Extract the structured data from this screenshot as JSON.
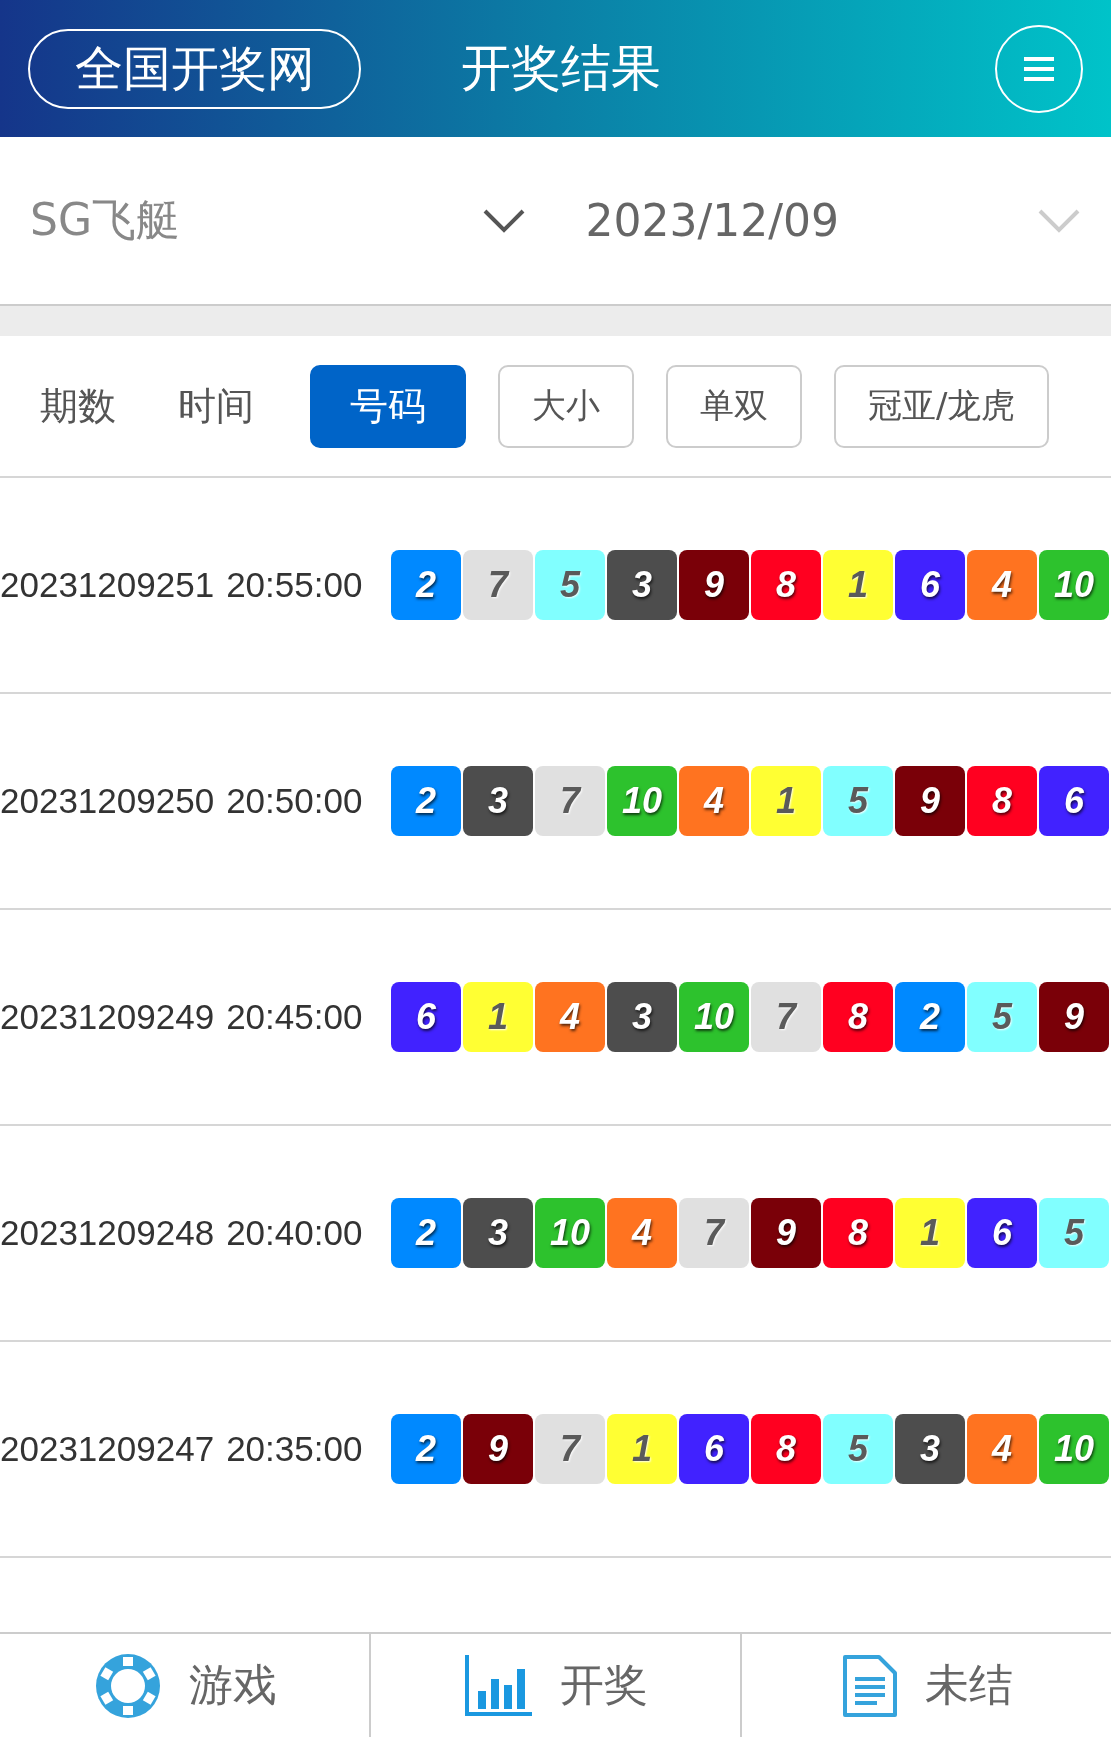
{
  "header": {
    "logo": "全国开奖网",
    "title": "开奖结果"
  },
  "filters": [
    {
      "value": "SG飞艇",
      "kind": "dark"
    },
    {
      "value": "2023/12/09",
      "kind": "light"
    }
  ],
  "tabs": [
    {
      "label": "期数",
      "kind": "text",
      "selected": false
    },
    {
      "label": "时间",
      "kind": "text",
      "selected": false
    },
    {
      "label": "号码",
      "kind": "button",
      "selected": true
    },
    {
      "label": "大小",
      "kind": "button",
      "selected": false
    },
    {
      "label": "单双",
      "kind": "button",
      "selected": false
    },
    {
      "label": "冠亚/龙虎",
      "kind": "button",
      "selected": false
    }
  ],
  "rows": [
    {
      "issue": "20231209251",
      "time": "20:55:00",
      "balls": [
        {
          "n": "2",
          "color": "#0089ff"
        },
        {
          "n": "7",
          "color": "#e0e0e0"
        },
        {
          "n": "5",
          "color": "#81ffff"
        },
        {
          "n": "3",
          "color": "#4d4d4d"
        },
        {
          "n": "9",
          "color": "#7a0008"
        },
        {
          "n": "8",
          "color": "#ff0020"
        },
        {
          "n": "1",
          "color": "#ffff33"
        },
        {
          "n": "6",
          "color": "#4122ff"
        },
        {
          "n": "4",
          "color": "#ff7320"
        },
        {
          "n": "10",
          "color": "#2dc22d"
        }
      ]
    },
    {
      "issue": "20231209250",
      "time": "20:50:00",
      "balls": [
        {
          "n": "2",
          "color": "#0089ff"
        },
        {
          "n": "3",
          "color": "#4d4d4d"
        },
        {
          "n": "7",
          "color": "#e0e0e0"
        },
        {
          "n": "10",
          "color": "#2dc22d"
        },
        {
          "n": "4",
          "color": "#ff7320"
        },
        {
          "n": "1",
          "color": "#ffff33"
        },
        {
          "n": "5",
          "color": "#81ffff"
        },
        {
          "n": "9",
          "color": "#7a0008"
        },
        {
          "n": "8",
          "color": "#ff0020"
        },
        {
          "n": "6",
          "color": "#4122ff"
        }
      ]
    },
    {
      "issue": "20231209249",
      "time": "20:45:00",
      "balls": [
        {
          "n": "6",
          "color": "#4122ff"
        },
        {
          "n": "1",
          "color": "#ffff33"
        },
        {
          "n": "4",
          "color": "#ff7320"
        },
        {
          "n": "3",
          "color": "#4d4d4d"
        },
        {
          "n": "10",
          "color": "#2dc22d"
        },
        {
          "n": "7",
          "color": "#e0e0e0"
        },
        {
          "n": "8",
          "color": "#ff0020"
        },
        {
          "n": "2",
          "color": "#0089ff"
        },
        {
          "n": "5",
          "color": "#81ffff"
        },
        {
          "n": "9",
          "color": "#7a0008"
        }
      ]
    },
    {
      "issue": "20231209248",
      "time": "20:40:00",
      "balls": [
        {
          "n": "2",
          "color": "#0089ff"
        },
        {
          "n": "3",
          "color": "#4d4d4d"
        },
        {
          "n": "10",
          "color": "#2dc22d"
        },
        {
          "n": "4",
          "color": "#ff7320"
        },
        {
          "n": "7",
          "color": "#e0e0e0"
        },
        {
          "n": "9",
          "color": "#7a0008"
        },
        {
          "n": "8",
          "color": "#ff0020"
        },
        {
          "n": "1",
          "color": "#ffff33"
        },
        {
          "n": "6",
          "color": "#4122ff"
        },
        {
          "n": "5",
          "color": "#81ffff"
        }
      ]
    },
    {
      "issue": "20231209247",
      "time": "20:35:00",
      "balls": [
        {
          "n": "2",
          "color": "#0089ff"
        },
        {
          "n": "9",
          "color": "#7a0008"
        },
        {
          "n": "7",
          "color": "#e0e0e0"
        },
        {
          "n": "1",
          "color": "#ffff33"
        },
        {
          "n": "6",
          "color": "#4122ff"
        },
        {
          "n": "8",
          "color": "#ff0020"
        },
        {
          "n": "5",
          "color": "#81ffff"
        },
        {
          "n": "3",
          "color": "#4d4d4d"
        },
        {
          "n": "4",
          "color": "#ff7320"
        },
        {
          "n": "10",
          "color": "#2dc22d"
        }
      ]
    }
  ],
  "nav": [
    {
      "label": "游戏",
      "kind": "chip"
    },
    {
      "label": "开奖",
      "kind": "chart"
    },
    {
      "label": "未结",
      "kind": "document"
    }
  ]
}
